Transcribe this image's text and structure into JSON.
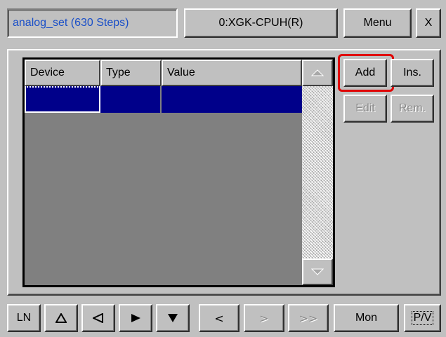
{
  "header": {
    "program_title": "analog_set (630 Steps)",
    "cpu_label": "0:XGK-CPUH(R)",
    "menu_label": "Menu",
    "close_label": "X"
  },
  "table": {
    "columns": [
      "Device",
      "Type",
      "Value"
    ],
    "rows": [
      {
        "device": "",
        "type": "",
        "value": ""
      }
    ],
    "selected_row": 0
  },
  "actions": {
    "add_label": "Add",
    "ins_label": "Ins.",
    "edit_label": "Edit",
    "rem_label": "Rem."
  },
  "footer": {
    "ln_label": "LN",
    "up_icon": "up-triangle-icon",
    "left_icon": "left-triangle-icon",
    "right_icon": "right-triangle-icon",
    "down_icon": "down-triangle-icon",
    "lt_label": "<",
    "gt_label": ">",
    "gtgt_label": ">>",
    "mon_label": "Mon",
    "pv_label": "P/V"
  },
  "colors": {
    "title_text": "#1a4fc8",
    "selection": "#00008a",
    "highlight_outline": "#e00000"
  }
}
